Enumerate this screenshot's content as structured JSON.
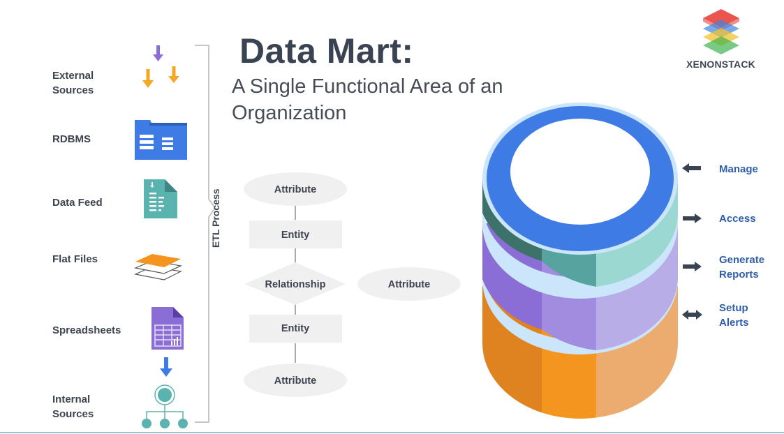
{
  "title": "Data Mart:",
  "subtitle": "A Single Functional Area of an Organization",
  "logo": {
    "name": "XENONSTACK",
    "icon": "layered-stack-logo-icon"
  },
  "sources": [
    {
      "label": "External Sources",
      "icon": "download-arrows-icon"
    },
    {
      "label": "RDBMS",
      "icon": "database-folder-icon"
    },
    {
      "label": "Data Feed",
      "icon": "document-feed-icon"
    },
    {
      "label": "Flat Files",
      "icon": "stacked-sheets-icon"
    },
    {
      "label": "Spreadsheets",
      "icon": "spreadsheet-icon"
    },
    {
      "label": "Internal Sources",
      "icon": "hierarchy-tree-icon"
    }
  ],
  "etl": {
    "label": "ETL Process",
    "nodes": [
      {
        "type": "attribute",
        "label": "Attribute"
      },
      {
        "type": "entity",
        "label": "Entity"
      },
      {
        "type": "relationship",
        "label": "Relationship"
      },
      {
        "type": "attribute",
        "label": "Attribute"
      },
      {
        "type": "entity",
        "label": "Entity"
      },
      {
        "type": "attribute",
        "label": "Attribute"
      }
    ]
  },
  "cylinder": {
    "rim_color": "#3f7be4",
    "layers": [
      {
        "name": "teal",
        "colors": [
          "#3c726a",
          "#56a39f",
          "#9cd8d2"
        ]
      },
      {
        "name": "purple",
        "colors": [
          "#8a6ed5",
          "#a18ce0",
          "#b8ade6"
        ]
      },
      {
        "name": "orange",
        "colors": [
          "#df8220",
          "#f4951f",
          "#ecab6f"
        ]
      }
    ]
  },
  "actions": [
    {
      "label": "Manage",
      "direction": "left"
    },
    {
      "label": "Access",
      "direction": "right"
    },
    {
      "label": "Generate Reports",
      "direction": "right"
    },
    {
      "label": "Setup Alerts",
      "direction": "both"
    }
  ]
}
